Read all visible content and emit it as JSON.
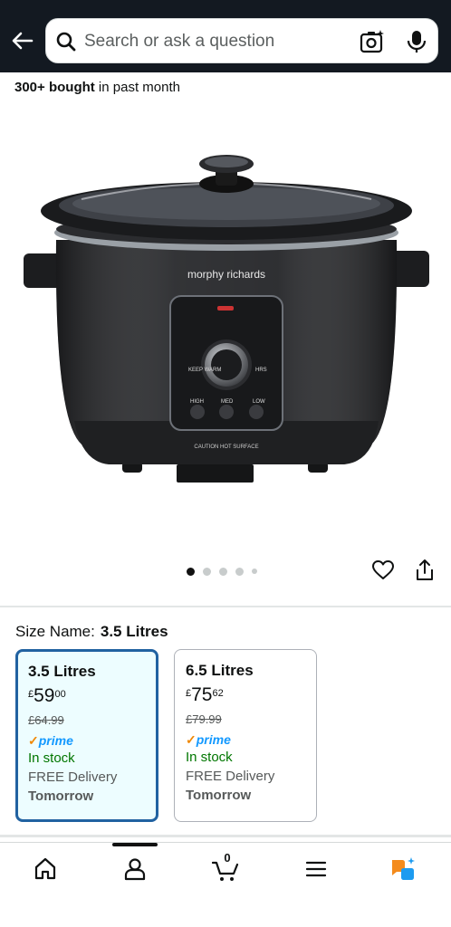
{
  "search": {
    "placeholder": "Search or ask a question"
  },
  "purchase_info": {
    "count": "300+ bought",
    "suffix": " in past month"
  },
  "carousel": {
    "image_alt": "morphy richards slow cooker",
    "slides": 5,
    "active_slide": 1
  },
  "product_labels": {
    "brand": "morphy richards",
    "caution": "CAUTION HOT SURFACE",
    "keep_warm": "KEEP WARM",
    "hrs": "HRS",
    "high": "HIGH",
    "med": "MED",
    "low": "LOW"
  },
  "size": {
    "label": "Size Name:",
    "value": "3.5 Litres"
  },
  "options": [
    {
      "title": "3.5 Litres",
      "currency": "£",
      "whole": "59",
      "fraction": "00",
      "was": "£64.99",
      "prime_label": "prime",
      "stock": "In stock",
      "delivery": "FREE Delivery",
      "when": "Tomorrow"
    },
    {
      "title": "6.5 Litres",
      "currency": "£",
      "whole": "75",
      "fraction": "62",
      "was": "£79.99",
      "prime_label": "prime",
      "stock": "In stock",
      "delivery": "FREE Delivery",
      "when": "Tomorrow"
    }
  ],
  "nav": {
    "cart_count": "0"
  },
  "colors": {
    "header": "#131921",
    "selected_border": "#2162a1",
    "selected_bg": "#edfdff",
    "stock_green": "#007600",
    "prime_blue": "#1399ff"
  },
  "icons": [
    "back-arrow-icon",
    "search-icon",
    "camera-icon",
    "microphone-icon",
    "heart-icon",
    "share-icon",
    "home-icon",
    "account-icon",
    "cart-icon",
    "menu-icon",
    "rufus-icon"
  ]
}
